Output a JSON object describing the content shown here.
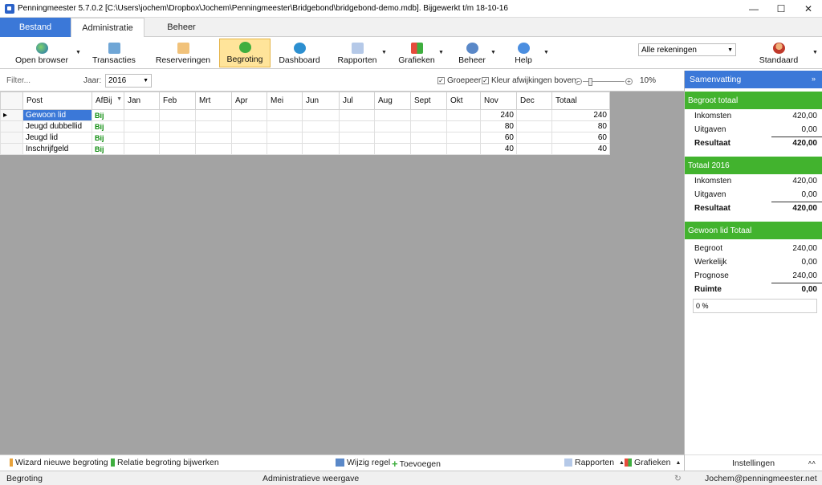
{
  "window": {
    "title": "Penningmeester 5.7.0.2 [C:\\Users\\jochem\\Dropbox\\Jochem\\Penningmeester\\Bridgebond\\bridgebond-demo.mdb]. Bijgewerkt t/m 18-10-16"
  },
  "tabs": {
    "bestand": "Bestand",
    "administratie": "Administratie",
    "beheer": "Beheer"
  },
  "ribbon": {
    "open_browser": "Open browser",
    "transacties": "Transacties",
    "reserveringen": "Reserveringen",
    "begroting": "Begroting",
    "dashboard": "Dashboard",
    "rapporten": "Rapporten",
    "grafieken": "Grafieken",
    "beheer": "Beheer",
    "help": "Help",
    "account_select": "Alle rekeningen",
    "standaard": "Standaard"
  },
  "filterbar": {
    "filter_placeholder": "Filter...",
    "jaar_label": "Jaar:",
    "jaar_value": "2016",
    "groepeer": "Groepeer",
    "kleur_afwijkingen": "Kleur afwijkingen boven:",
    "percentage": "10%"
  },
  "grid": {
    "headers": [
      "Post",
      "AfBij",
      "Jan",
      "Feb",
      "Mrt",
      "Apr",
      "Mei",
      "Jun",
      "Jul",
      "Aug",
      "Sept",
      "Okt",
      "Nov",
      "Dec",
      "Totaal"
    ],
    "rows": [
      {
        "post": "Gewoon lid",
        "afbij": "Bij",
        "nov": "240",
        "totaal": "240"
      },
      {
        "post": "Jeugd dubbellid",
        "afbij": "Bij",
        "nov": "80",
        "totaal": "80"
      },
      {
        "post": "Jeugd lid",
        "afbij": "Bij",
        "nov": "60",
        "totaal": "60"
      },
      {
        "post": "Inschrijfgeld",
        "afbij": "Bij",
        "nov": "40",
        "totaal": "40"
      }
    ]
  },
  "bottombar": {
    "wizard": "Wizard nieuwe begroting",
    "relatie": "Relatie begroting bijwerken",
    "wijzig": "Wijzig regel",
    "toevoegen": "Toevoegen",
    "rapporten": "Rapporten",
    "grafieken": "Grafieken"
  },
  "summary": {
    "title": "Samenvatting",
    "begroot_totaal": {
      "title": "Begroot totaal",
      "inkomsten_label": "Inkomsten",
      "inkomsten": "420,00",
      "uitgaven_label": "Uitgaven",
      "uitgaven": "0,00",
      "resultaat_label": "Resultaat",
      "resultaat": "420,00"
    },
    "totaal_2016": {
      "title": "Totaal 2016",
      "inkomsten_label": "Inkomsten",
      "inkomsten": "420,00",
      "uitgaven_label": "Uitgaven",
      "uitgaven": "0,00",
      "resultaat_label": "Resultaat",
      "resultaat": "420,00"
    },
    "gewoon_lid": {
      "title": "Gewoon lid Totaal",
      "begroot_label": "Begroot",
      "begroot": "240,00",
      "werkelijk_label": "Werkelijk",
      "werkelijk": "0,00",
      "prognose_label": "Prognose",
      "prognose": "240,00",
      "ruimte_label": "Ruimte",
      "ruimte": "0,00",
      "progress": "0 %"
    },
    "instellingen": "Instellingen"
  },
  "status": {
    "left": "Begroting",
    "center": "Administratieve weergave",
    "email": "Jochem@penningmeester.net"
  }
}
